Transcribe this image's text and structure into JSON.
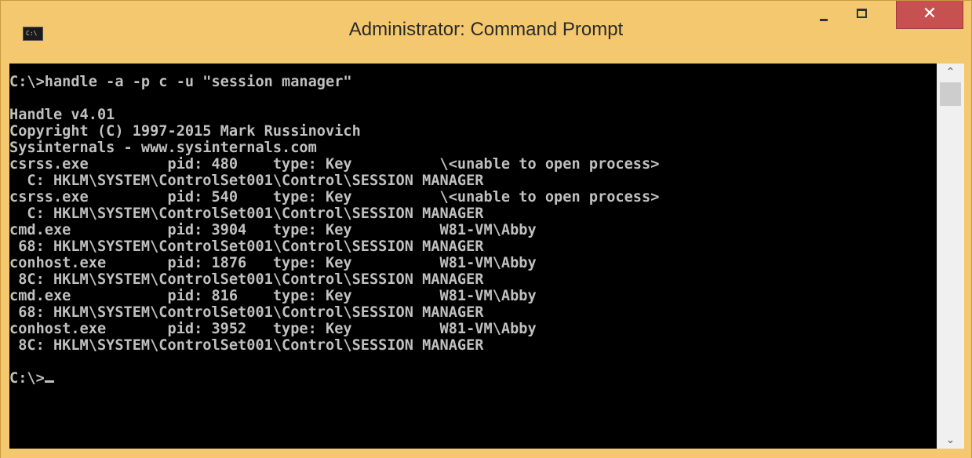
{
  "window": {
    "title": "Administrator: Command Prompt",
    "icon_label": "C:\\",
    "buttons": {
      "minimize_icon": "minimize-icon",
      "maximize_icon": "maximize-icon",
      "close_label": "✕"
    },
    "colors": {
      "frame": "#f4c86e",
      "close": "#c75050",
      "console_bg": "#000000",
      "console_text": "#c0c0c0"
    }
  },
  "console": {
    "lines": [
      "C:\\>handle -a -p c -u \"session manager\"",
      "",
      "Handle v4.01",
      "Copyright (C) 1997-2015 Mark Russinovich",
      "Sysinternals - www.sysinternals.com",
      "csrss.exe         pid: 480    type: Key          \\<unable to open process>",
      "  C: HKLM\\SYSTEM\\ControlSet001\\Control\\SESSION MANAGER",
      "csrss.exe         pid: 540    type: Key          \\<unable to open process>",
      "  C: HKLM\\SYSTEM\\ControlSet001\\Control\\SESSION MANAGER",
      "cmd.exe           pid: 3904   type: Key          W81-VM\\Abby",
      " 68: HKLM\\SYSTEM\\ControlSet001\\Control\\SESSION MANAGER",
      "conhost.exe       pid: 1876   type: Key          W81-VM\\Abby",
      " 8C: HKLM\\SYSTEM\\ControlSet001\\Control\\SESSION MANAGER",
      "cmd.exe           pid: 816    type: Key          W81-VM\\Abby",
      " 68: HKLM\\SYSTEM\\ControlSet001\\Control\\SESSION MANAGER",
      "conhost.exe       pid: 3952   type: Key          W81-VM\\Abby",
      " 8C: HKLM\\SYSTEM\\ControlSet001\\Control\\SESSION MANAGER",
      "",
      "C:\\>"
    ]
  },
  "scrollbar": {
    "up_icon": "▲",
    "down_icon": "▼",
    "position": 0
  }
}
